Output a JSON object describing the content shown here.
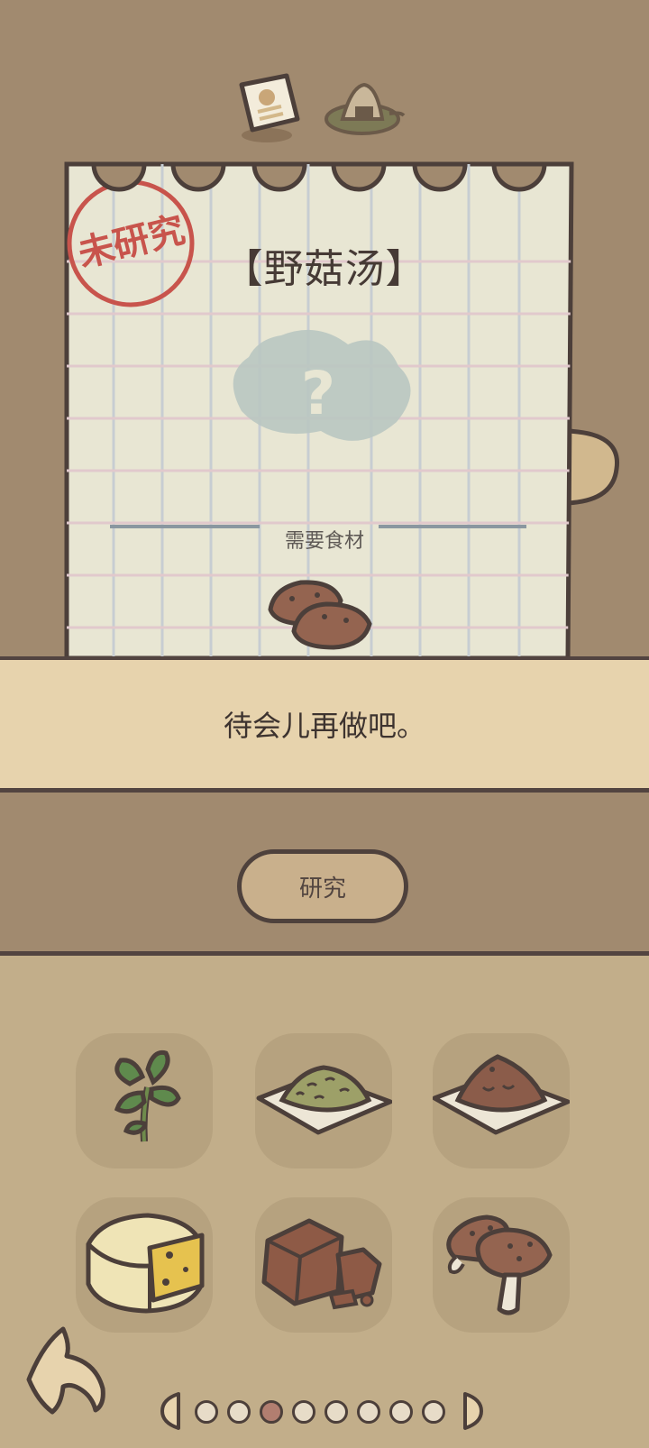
{
  "recipe": {
    "title": "【野菇汤】",
    "stamp": "未研究",
    "unknown_mark": "?",
    "ingredients_label": "需要食材"
  },
  "message": "待会儿再做吧。",
  "research_button": "研究",
  "ingredient_slots": [
    {
      "name": "herb-sprig",
      "row": 1,
      "col": 1
    },
    {
      "name": "grain-flakes-plate",
      "row": 1,
      "col": 2
    },
    {
      "name": "ground-meat-plate",
      "row": 1,
      "col": 3
    },
    {
      "name": "cheese-wheel",
      "row": 2,
      "col": 1
    },
    {
      "name": "chocolate-chunks",
      "row": 2,
      "col": 2
    },
    {
      "name": "mushrooms",
      "row": 2,
      "col": 3
    }
  ],
  "pager": {
    "total": 8,
    "active": 3
  },
  "colors": {
    "background": "#a18a6f",
    "panel": "#c2ae8a",
    "message_band": "#e7d3ad",
    "stamp_red": "#c8544c",
    "outline": "#524440"
  }
}
